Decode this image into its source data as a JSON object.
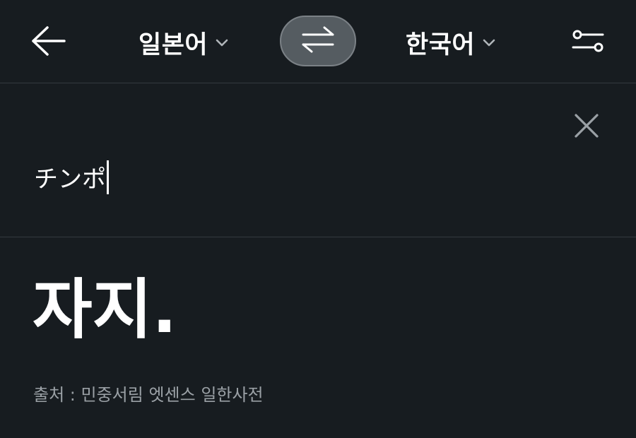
{
  "header": {
    "source_language": "일본어",
    "target_language": "한국어",
    "back_icon": "arrow-left-icon",
    "swap_icon": "swap-arrows-icon",
    "settings_icon": "toggles-settings-icon",
    "dropdown_icon": "chevron-down-icon"
  },
  "input": {
    "text": "チンポ",
    "clear_icon": "close-icon"
  },
  "result": {
    "translation": "자지.",
    "source_note": "출처 : 민중서림 엣센스 일한사전"
  },
  "colors": {
    "background": "#171c20",
    "divider": "#343a40",
    "swap_button_bg": "#555c61",
    "muted_text": "#9aa0a5"
  }
}
